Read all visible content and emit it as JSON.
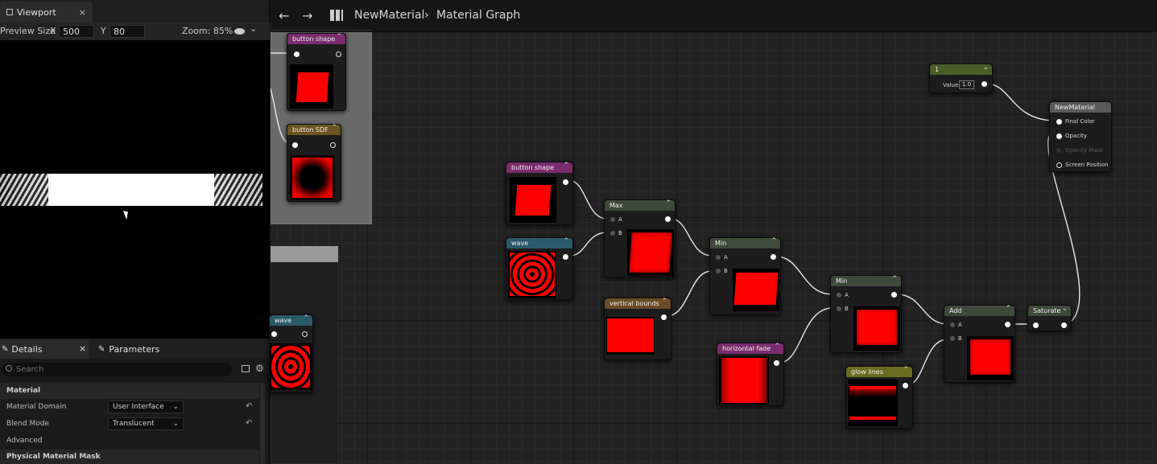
{
  "viewport_panel": {
    "tab_label": "Viewport",
    "close": "×",
    "preview_size_label": "Preview Size",
    "x_label": "X",
    "x_value": "500",
    "y_label": "Y",
    "y_value": "80",
    "zoom": "Zoom: 85%",
    "eye_chevron": "⌄"
  },
  "details_panel": {
    "details_tab": "Details",
    "details_close": "×",
    "parameters_tab": "Parameters",
    "search_placeholder": "Search",
    "section_material": "Material",
    "material_domain_label": "Material Domain",
    "material_domain_value": "User Interface",
    "blend_mode_label": "Blend Mode",
    "blend_mode_value": "Translucent",
    "advanced_label": "Advanced",
    "physical_material_mask_label": "Physical Material Mask"
  },
  "breadcrumb": {
    "material": "NewMaterial",
    "separator": "›",
    "graph": "Material Graph"
  },
  "nodes": {
    "button_shape_a": "button shape",
    "button_sdf": "button SDF",
    "wave_left": "wave",
    "button_shape": "button shape",
    "wave": "wave",
    "max": "Max",
    "vertical_bounds": "vertical bounds",
    "min1": "Min",
    "horizontal_fade": "horizontal fade",
    "min2": "Min",
    "glow_lines": "glow lines",
    "add": "Add",
    "saturate": "Saturate",
    "constant": "1",
    "constant_value_label": "Value",
    "constant_value": "1.0",
    "result_title": "NewMaterial",
    "result_pins": [
      "Final Color",
      "Opacity",
      "Opacity Mask",
      "Screen Position"
    ],
    "pin_a": "A",
    "pin_b": "B"
  },
  "colors": {
    "param_header": "#7a2d6e",
    "texture_header": "#2a5a6a",
    "math_header": "#3d4a3a",
    "sdf_header": "#6b5520",
    "vbounds_header": "#6b4a25",
    "glow_header": "#6b6b20",
    "const_header": "#4a5e28",
    "red": "#ff0000"
  },
  "icons": [
    "viewport-icon",
    "eye-icon",
    "back-arrow-icon",
    "forward-arrow-icon",
    "graph-icon",
    "details-icon",
    "parameters-icon",
    "search-icon",
    "table-view-icon",
    "gear-icon",
    "reset-icon"
  ]
}
